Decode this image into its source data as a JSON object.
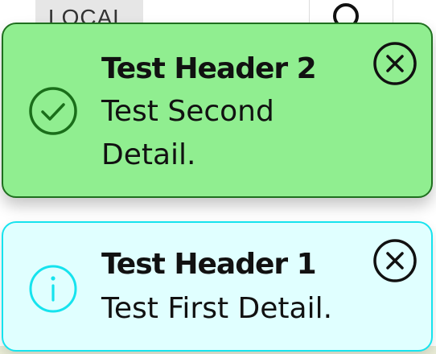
{
  "background": {
    "local_chip_label": "LOCAL"
  },
  "toasts": [
    {
      "type": "success",
      "header": "Test Header 2",
      "detail": "Test Second Detail.",
      "icon": "check-circle-icon",
      "close_icon": "close-circle-icon",
      "background_color": "#90ee90",
      "border_color": "#1f6f1f"
    },
    {
      "type": "info",
      "header": "Test Header 1",
      "detail": "Test First Detail.",
      "icon": "info-circle-icon",
      "close_icon": "close-circle-icon",
      "background_color": "#e0ffff",
      "border_color": "#16e3ee"
    }
  ]
}
